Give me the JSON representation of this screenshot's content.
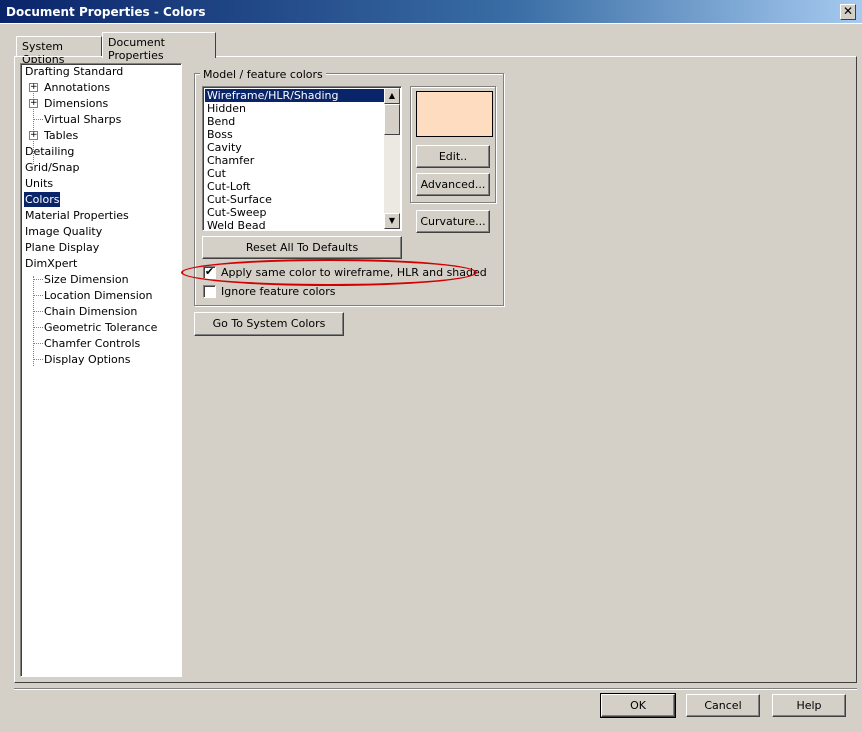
{
  "window": {
    "title": "Document Properties - Colors",
    "close_glyph": "✕"
  },
  "tabs": [
    {
      "label": "System Options",
      "active": false
    },
    {
      "label": "Document Properties",
      "active": true
    }
  ],
  "tree": {
    "items": [
      {
        "label": "Drafting Standard",
        "level": 0,
        "expandable": false
      },
      {
        "label": "Annotations",
        "level": 1,
        "expandable": true
      },
      {
        "label": "Dimensions",
        "level": 1,
        "expandable": true
      },
      {
        "label": "Virtual Sharps",
        "level": 1,
        "expandable": false
      },
      {
        "label": "Tables",
        "level": 1,
        "expandable": true
      },
      {
        "label": "Detailing",
        "level": 0,
        "expandable": false
      },
      {
        "label": "Grid/Snap",
        "level": 0,
        "expandable": false
      },
      {
        "label": "Units",
        "level": 0,
        "expandable": false
      },
      {
        "label": "Colors",
        "level": 0,
        "expandable": false,
        "selected": true
      },
      {
        "label": "Material Properties",
        "level": 0,
        "expandable": false
      },
      {
        "label": "Image Quality",
        "level": 0,
        "expandable": false
      },
      {
        "label": "Plane Display",
        "level": 0,
        "expandable": false
      },
      {
        "label": "DimXpert",
        "level": 0,
        "expandable": false
      },
      {
        "label": "Size Dimension",
        "level": 1,
        "expandable": false
      },
      {
        "label": "Location Dimension",
        "level": 1,
        "expandable": false
      },
      {
        "label": "Chain Dimension",
        "level": 1,
        "expandable": false
      },
      {
        "label": "Geometric Tolerance",
        "level": 1,
        "expandable": false
      },
      {
        "label": "Chamfer Controls",
        "level": 1,
        "expandable": false
      },
      {
        "label": "Display Options",
        "level": 1,
        "expandable": false
      }
    ],
    "expand_glyph": "+"
  },
  "model_colors": {
    "group_label": "Model / feature colors",
    "list": [
      "Wireframe/HLR/Shading",
      "Hidden",
      "Bend",
      "Boss",
      "Cavity",
      "Chamfer",
      "Cut",
      "Cut-Loft",
      "Cut-Surface",
      "Cut-Sweep",
      "Weld Bead"
    ],
    "selected_item": "Wireframe/HLR/Shading",
    "swatch_color": "#fddcc0",
    "edit_label": "Edit..",
    "advanced_label": "Advanced...",
    "curvature_label": "Curvature...",
    "reset_label": "Reset All To Defaults",
    "apply_same_color": {
      "label": "Apply same color to wireframe, HLR and shaded",
      "checked": true
    },
    "ignore_feature_colors": {
      "label": "Ignore feature colors",
      "checked": false
    },
    "highlight_color": "#d40000"
  },
  "go_to_system_colors_label": "Go To System Colors",
  "footer": {
    "ok_label": "OK",
    "cancel_label": "Cancel",
    "help_label": "Help"
  },
  "scroll_glyphs": {
    "up": "▲",
    "down": "▼"
  },
  "check_glyph": "✔"
}
